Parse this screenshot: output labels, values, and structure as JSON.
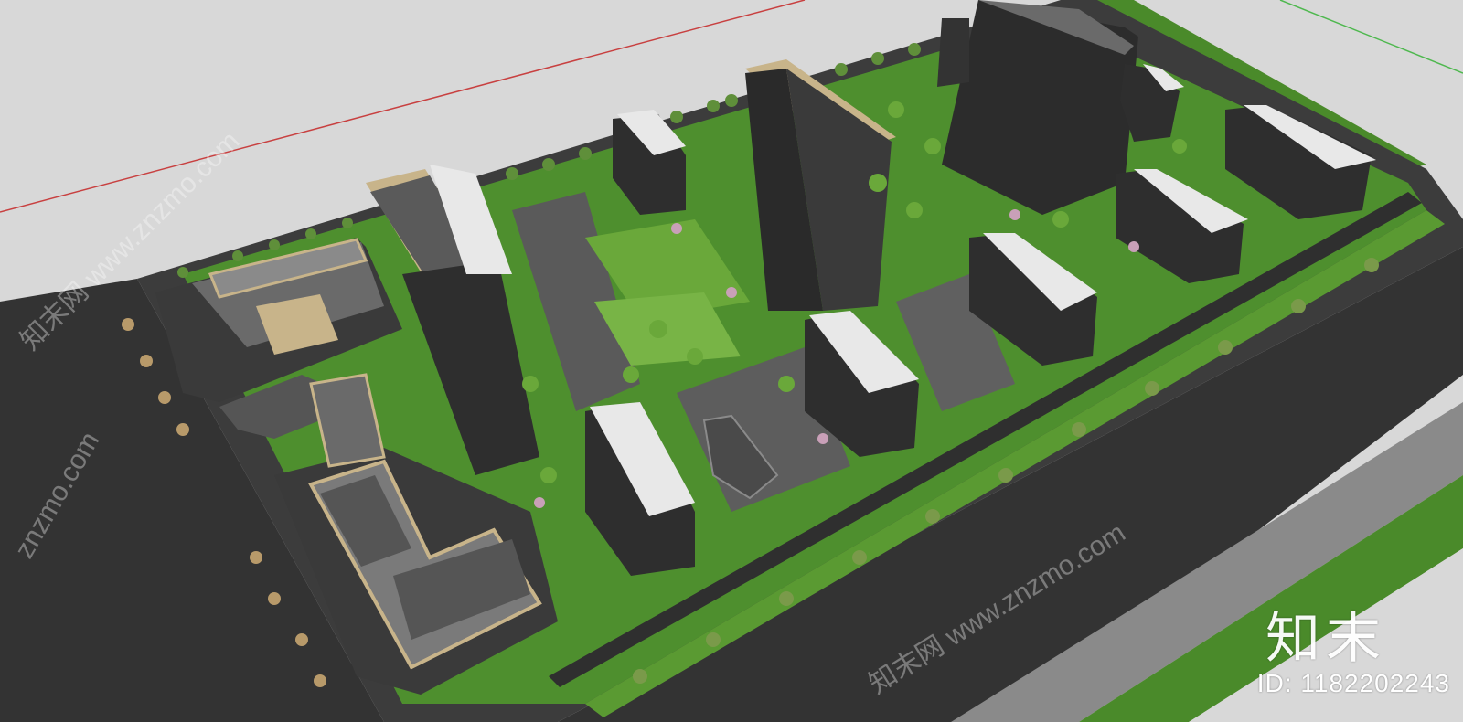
{
  "scene": {
    "colors": {
      "sky_ground": "#d8d8d8",
      "road": "#3a3a3a",
      "sidewalk": "#8a8a8a",
      "grass": "#4a8a2a",
      "grass_light": "#6aa83a",
      "building_dark": "#2e2e2e",
      "building_roof": "#e8e8e8",
      "accent_tan": "#c8b48a",
      "tree_green": "#5f8f3a",
      "tree_pink": "#c9a0b8",
      "red_line": "#c84040"
    },
    "icons": [
      "aerial-city-model"
    ]
  },
  "watermark": {
    "brand": "知末",
    "id_text": "ID: 1182202243",
    "diagonal": "znzmo.com",
    "diagonal_full": "知末网 www.znzmo.com"
  }
}
